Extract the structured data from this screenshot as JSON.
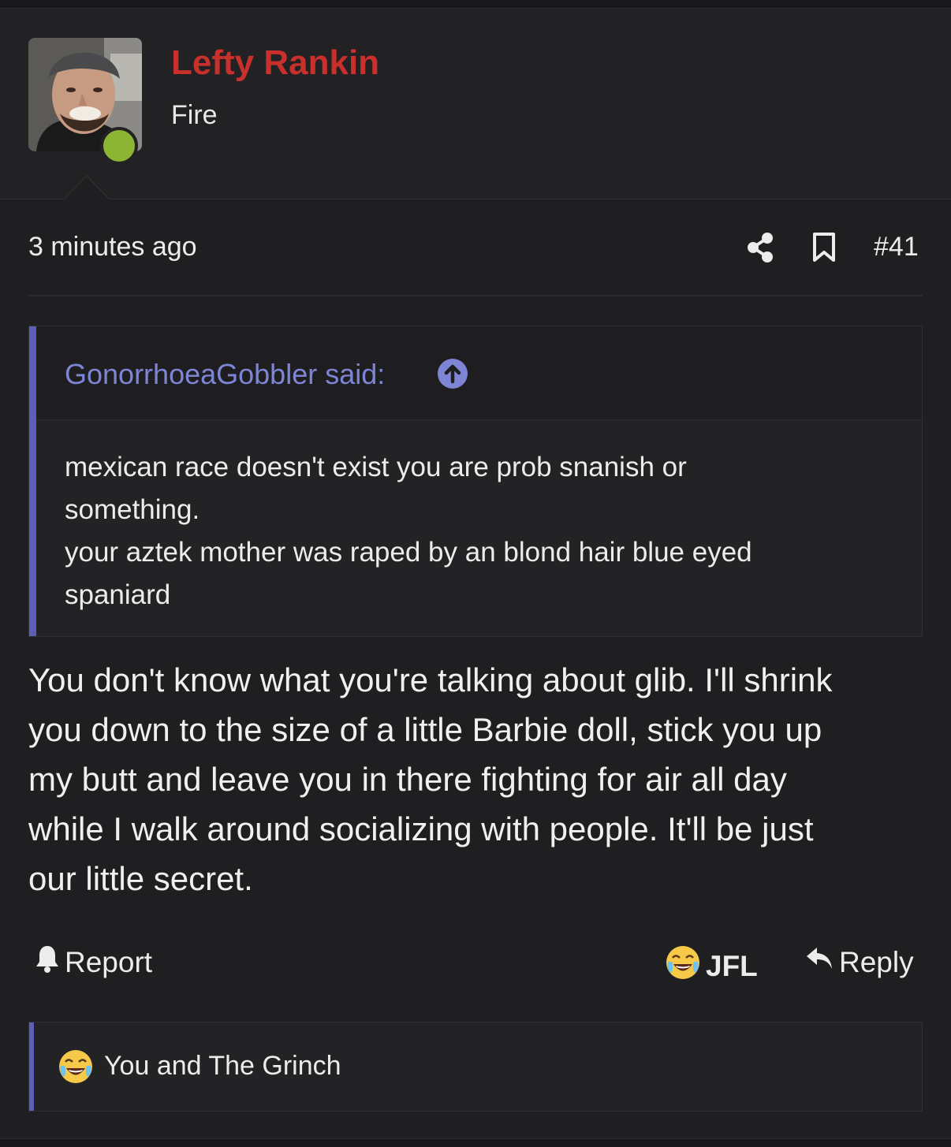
{
  "user": {
    "name": "Lefty Rankin",
    "title": "Fire",
    "online": true,
    "avatar_icon": "user-photo-avatar",
    "name_color": "#c9302c",
    "online_color": "#8db534"
  },
  "post": {
    "time": "3 minutes ago",
    "number": "#41",
    "icons": [
      "share-icon",
      "bookmark-icon"
    ],
    "quote": {
      "author_label": "GonorrhoeaGobbler said:",
      "jump_icon": "arrow-up-circle-icon",
      "lines": [
        "mexican race doesn't exist you are prob snanish or",
        "something.",
        "your aztek mother was raped by an blond hair blue eyed",
        "spaniard"
      ]
    },
    "body_lines": [
      "You don't know what you're talking about glib. I'll shrink",
      "you down to the size of a little Barbie doll, stick you up",
      "my butt and leave you in there fighting for air all day",
      "while I walk around socializing with people. It'll be just",
      "our little secret."
    ]
  },
  "actions": {
    "report_label": "Report",
    "report_icon": "bell-icon",
    "jfl_label": "JFL",
    "jfl_icon": "crying-laughing-emoji-icon",
    "reply_label": "Reply",
    "reply_icon": "reply-arrow-icon"
  },
  "reactions": {
    "emoji_icon": "crying-laughing-emoji-icon",
    "text": "You and The Grinch"
  },
  "colors": {
    "background": "#1f1f21",
    "quote_accent": "#5b5fb8",
    "quote_author": "#7e85d6"
  }
}
